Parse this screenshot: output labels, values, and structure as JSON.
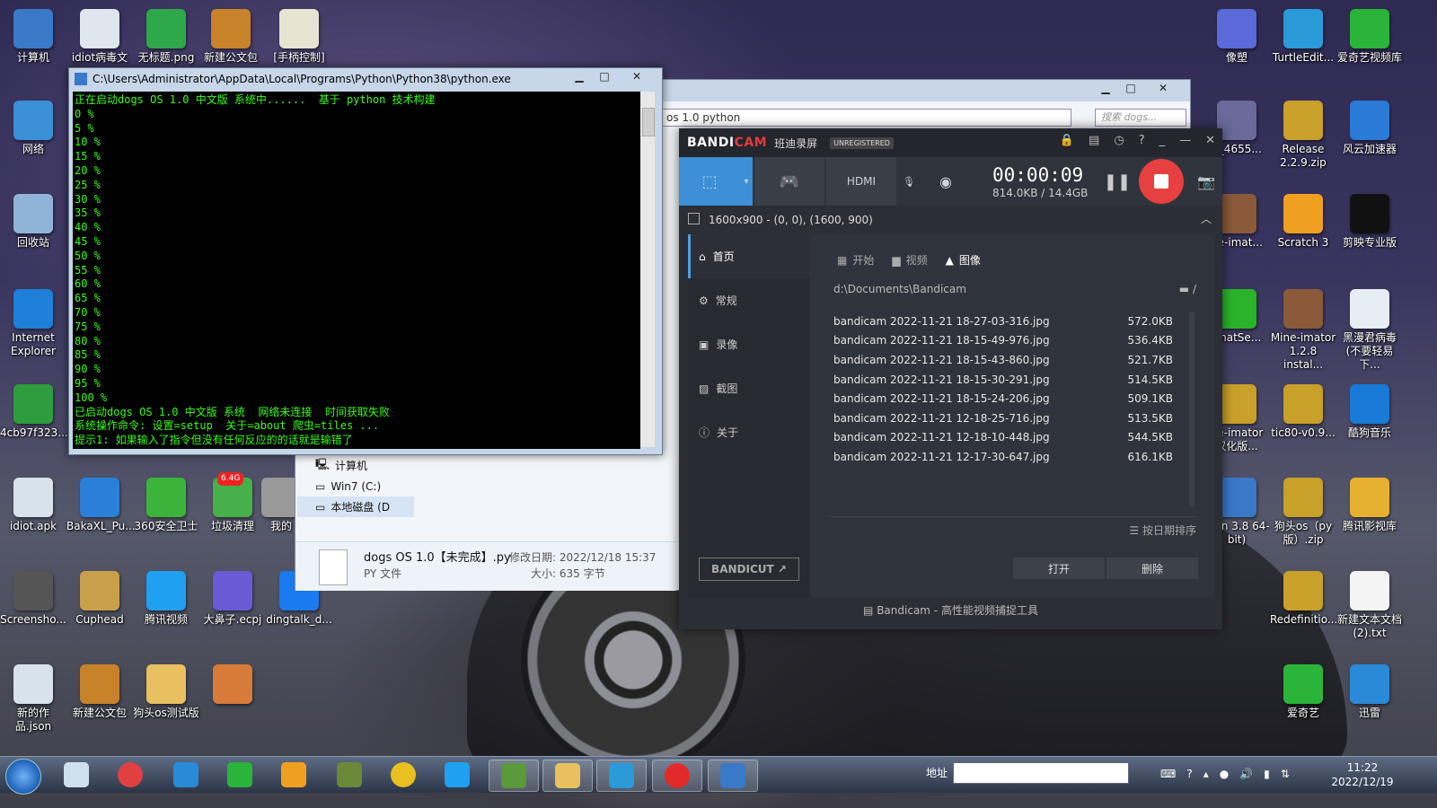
{
  "console": {
    "title": "C:\\Users\\Administrator\\AppData\\Local\\Programs\\Python\\Python38\\python.exe",
    "lines": [
      "正在启动dogs OS 1.0 中文版 系统中......  基于 python 技术构建",
      "0 %",
      "5 %",
      "10 %",
      "15 %",
      "20 %",
      "25 %",
      "30 %",
      "35 %",
      "40 %",
      "45 %",
      "50 %",
      "55 %",
      "60 %",
      "65 %",
      "70 %",
      "75 %",
      "80 %",
      "85 %",
      "90 %",
      "95 %",
      "100 %",
      "已启动dogs OS 1.0 中文版 系统  网络未连接  时间获取失败",
      "系统操作命令: 设置=setup  关于=about 爬虫=tiles ...",
      "提示1: 如果输入了指令但没有任何反应的的话就是输错了"
    ]
  },
  "explorer": {
    "address": "os 1.0 python",
    "search_placeholder": "搜索 dogs...",
    "tree": [
      "计算机",
      "Win7 (C:)",
      "本地磁盘 (D"
    ],
    "detail_name": "dogs OS 1.0【未完成】.py",
    "detail_type": "PY 文件",
    "detail_modified": "修改日期: 2022/12/18 15:37",
    "detail_size": "大小: 635 字节"
  },
  "bandicam": {
    "logo_a": "BANDI",
    "logo_b": "CAM",
    "logo_cn": "班迪录屏",
    "unregistered": "UNREGISTERED",
    "timer": "00:00:09",
    "size": "814.0KB / 14.4GB",
    "region": "1600x900 - (0, 0), (1600, 900)",
    "sidebar": [
      "首页",
      "常规",
      "录像",
      "截图",
      "关于"
    ],
    "tabs": [
      "开始",
      "视频",
      "图像"
    ],
    "path": "d:\\Documents\\Bandicam",
    "files": [
      {
        "name": "bandicam 2022-11-21 18-27-03-316.jpg",
        "size": "572.0KB"
      },
      {
        "name": "bandicam 2022-11-21 18-15-49-976.jpg",
        "size": "536.4KB"
      },
      {
        "name": "bandicam 2022-11-21 18-15-43-860.jpg",
        "size": "521.7KB"
      },
      {
        "name": "bandicam 2022-11-21 18-15-30-291.jpg",
        "size": "514.5KB"
      },
      {
        "name": "bandicam 2022-11-21 18-15-24-206.jpg",
        "size": "509.1KB"
      },
      {
        "name": "bandicam 2022-11-21 12-18-25-716.jpg",
        "size": "513.5KB"
      },
      {
        "name": "bandicam 2022-11-21 12-18-10-448.jpg",
        "size": "544.5KB"
      },
      {
        "name": "bandicam 2022-11-21 12-17-30-647.jpg",
        "size": "616.1KB"
      }
    ],
    "sort_label": "按日期排序",
    "open_label": "打开",
    "delete_label": "删除",
    "bandicut": "BANDICUT",
    "footer": "Bandicam - 高性能视频捕捉工具"
  },
  "desktop_left": [
    {
      "label": "计算机",
      "color": "#3a78c8"
    },
    {
      "label": "idiot病毒文",
      "color": "#dfe6ee"
    },
    {
      "label": "无标题.png",
      "color": "#2ea84a"
    },
    {
      "label": "新建公文包",
      "color": "#c8822a"
    },
    {
      "label": "[手柄控制]",
      "color": "#e8e4d2"
    },
    {
      "label": "网络",
      "color": "#3b8fd6"
    },
    {
      "label": "回收站",
      "color": "#8fb4d8"
    },
    {
      "label": "Internet Explorer",
      "color": "#1e7fd8"
    },
    {
      "label": "4cb97f323...",
      "color": "#2f9d3f"
    },
    {
      "label": "idiot.apk",
      "color": "#d8e2ea"
    },
    {
      "label": "BakaXL_Pu...",
      "color": "#2a7fd8"
    },
    {
      "label": "360安全卫士",
      "color": "#3cb43c"
    },
    {
      "label": "垃圾清理",
      "color": "#48b04a"
    },
    {
      "label": "我的",
      "color": "#999999"
    },
    {
      "label": "Screensho...",
      "color": "#555555"
    },
    {
      "label": "Cuphead",
      "color": "#c8a04a"
    },
    {
      "label": "腾讯视频",
      "color": "#1fa0f0"
    },
    {
      "label": "大鼻子.ecpj",
      "color": "#6a5ad6"
    },
    {
      "label": "dingtalk_d...",
      "color": "#1a7af0"
    },
    {
      "label": "新的作品.json",
      "color": "#d8e2ea"
    },
    {
      "label": "新建公文包",
      "color": "#c8822a"
    },
    {
      "label": "狗头os测试版",
      "color": "#e8c060"
    },
    {
      "label": "",
      "color": "#d87a3a"
    }
  ],
  "desktop_right": [
    {
      "label": "像塑",
      "color": "#5a6ad8"
    },
    {
      "label": "TurtleEdit...",
      "color": "#2a9ad8"
    },
    {
      "label": "爱奇艺视频库",
      "color": "#2ab43a"
    },
    {
      "label": "n_4655...",
      "color": "#6a6a9a"
    },
    {
      "label": "Release 2.2.9.zip",
      "color": "#c8a02a"
    },
    {
      "label": "风云加速器",
      "color": "#2a7ad8"
    },
    {
      "label": "ne-imat...",
      "color": "#8a5a3a"
    },
    {
      "label": "Scratch 3",
      "color": "#f0a020"
    },
    {
      "label": "剪映专业版",
      "color": "#111111"
    },
    {
      "label": "ChatSe...",
      "color": "#2ab42a"
    },
    {
      "label": "Mine-imator 1.2.8 instal...",
      "color": "#8a5a3a"
    },
    {
      "label": "黑漫君病毒 (不要轻易下...",
      "color": "#e6eef4"
    },
    {
      "label": "ne-imator 汉化版...",
      "color": "#c8a02a"
    },
    {
      "label": "tic80-v0.9...",
      "color": "#c8a02a"
    },
    {
      "label": "酷狗音乐",
      "color": "#1a7ad8"
    },
    {
      "label": "thon 3.8 64-bit)",
      "color": "#3a78c8"
    },
    {
      "label": "狗头os（py版）.zip",
      "color": "#c8a02a"
    },
    {
      "label": "腾讯影视库",
      "color": "#e8b030"
    },
    {
      "label": "Redefinitio...",
      "color": "#c8a02a"
    },
    {
      "label": "新建文本文档 (2).txt",
      "color": "#f4f4f4"
    },
    {
      "label": "爱奇艺",
      "color": "#2ab43a"
    },
    {
      "label": "迅雷",
      "color": "#2a8ad8"
    }
  ],
  "badge_label": "6.4G",
  "taskbar": {
    "address_label": "地址",
    "time": "11:22",
    "date": "2022/12/19",
    "apps": [
      {
        "name": "notepad",
        "color": "#cfe0ee"
      },
      {
        "name": "app-circle",
        "color": "#e04040"
      },
      {
        "name": "thunder",
        "color": "#2a8ad8"
      },
      {
        "name": "iqiyi",
        "color": "#2ab43a"
      },
      {
        "name": "colorful",
        "color": "#f0a020"
      },
      {
        "name": "minecraft",
        "color": "#6a8a3a"
      },
      {
        "name": "chrome",
        "color": "#e8c020"
      },
      {
        "name": "tencent-video",
        "color": "#1fa0f0"
      },
      {
        "name": "minecraft-block",
        "color": "#5a9a3a"
      },
      {
        "name": "explorer",
        "color": "#e8c060"
      },
      {
        "name": "turtle",
        "color": "#2a9ad8"
      },
      {
        "name": "bandicam",
        "color": "#e22a2a"
      },
      {
        "name": "python",
        "color": "#3a78c8"
      }
    ]
  }
}
